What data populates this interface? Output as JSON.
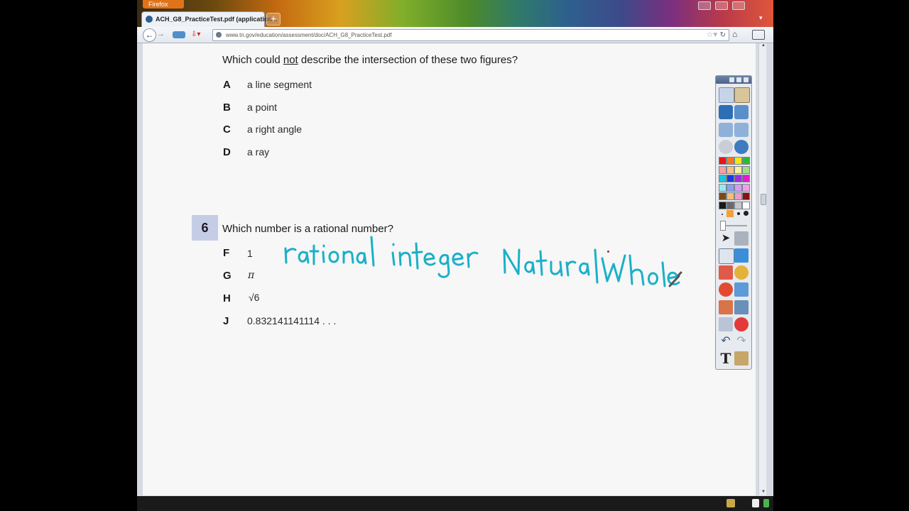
{
  "browser": {
    "app_button": "Firefox",
    "tab_title": "ACH_G8_PracticeTest.pdf (application...",
    "new_tab_label": "+",
    "url": "www.tn.gov/education/assessment/doc/ACH_G8_PracticeTest.pdf"
  },
  "doc": {
    "q5": {
      "prefix": "Which could ",
      "emph": "not",
      "suffix": " describe the intersection of these two figures?",
      "options": [
        {
          "letter": "A",
          "text": "a line segment"
        },
        {
          "letter": "B",
          "text": "a point"
        },
        {
          "letter": "C",
          "text": "a right angle"
        },
        {
          "letter": "D",
          "text": "a ray"
        }
      ]
    },
    "q6": {
      "number": "6",
      "question": "Which number is a rational number?",
      "options": [
        {
          "letter": "F",
          "text": "1"
        },
        {
          "letter": "G",
          "text": "π"
        },
        {
          "letter": "H",
          "text": "√6"
        },
        {
          "letter": "J",
          "text": "0.832141141114 . . ."
        }
      ]
    }
  },
  "annotations": {
    "ink_color": "#1ab0c8",
    "accent_dot_color": "#a0206f",
    "words": [
      "rational",
      "integer",
      "Natural",
      "Whole"
    ]
  },
  "toolbar": {
    "colors": [
      "#e8141c",
      "#f07b1c",
      "#f7e41c",
      "#2cba36",
      "#f4a2a4",
      "#f6c08a",
      "#f8f19a",
      "#9fdd8c",
      "#19c6dc",
      "#1a3be0",
      "#9a2ee0",
      "#e01ccf",
      "#9ae8f0",
      "#8aa0f0",
      "#cfa0f0",
      "#f0a0e6",
      "#7a4a16",
      "#f2c07a",
      "#e89cc8",
      "#8a1010",
      "#1a1a1a",
      "#6a6a6a",
      "#c8c8c8",
      "#ffffff"
    ],
    "text_tool": "T"
  }
}
